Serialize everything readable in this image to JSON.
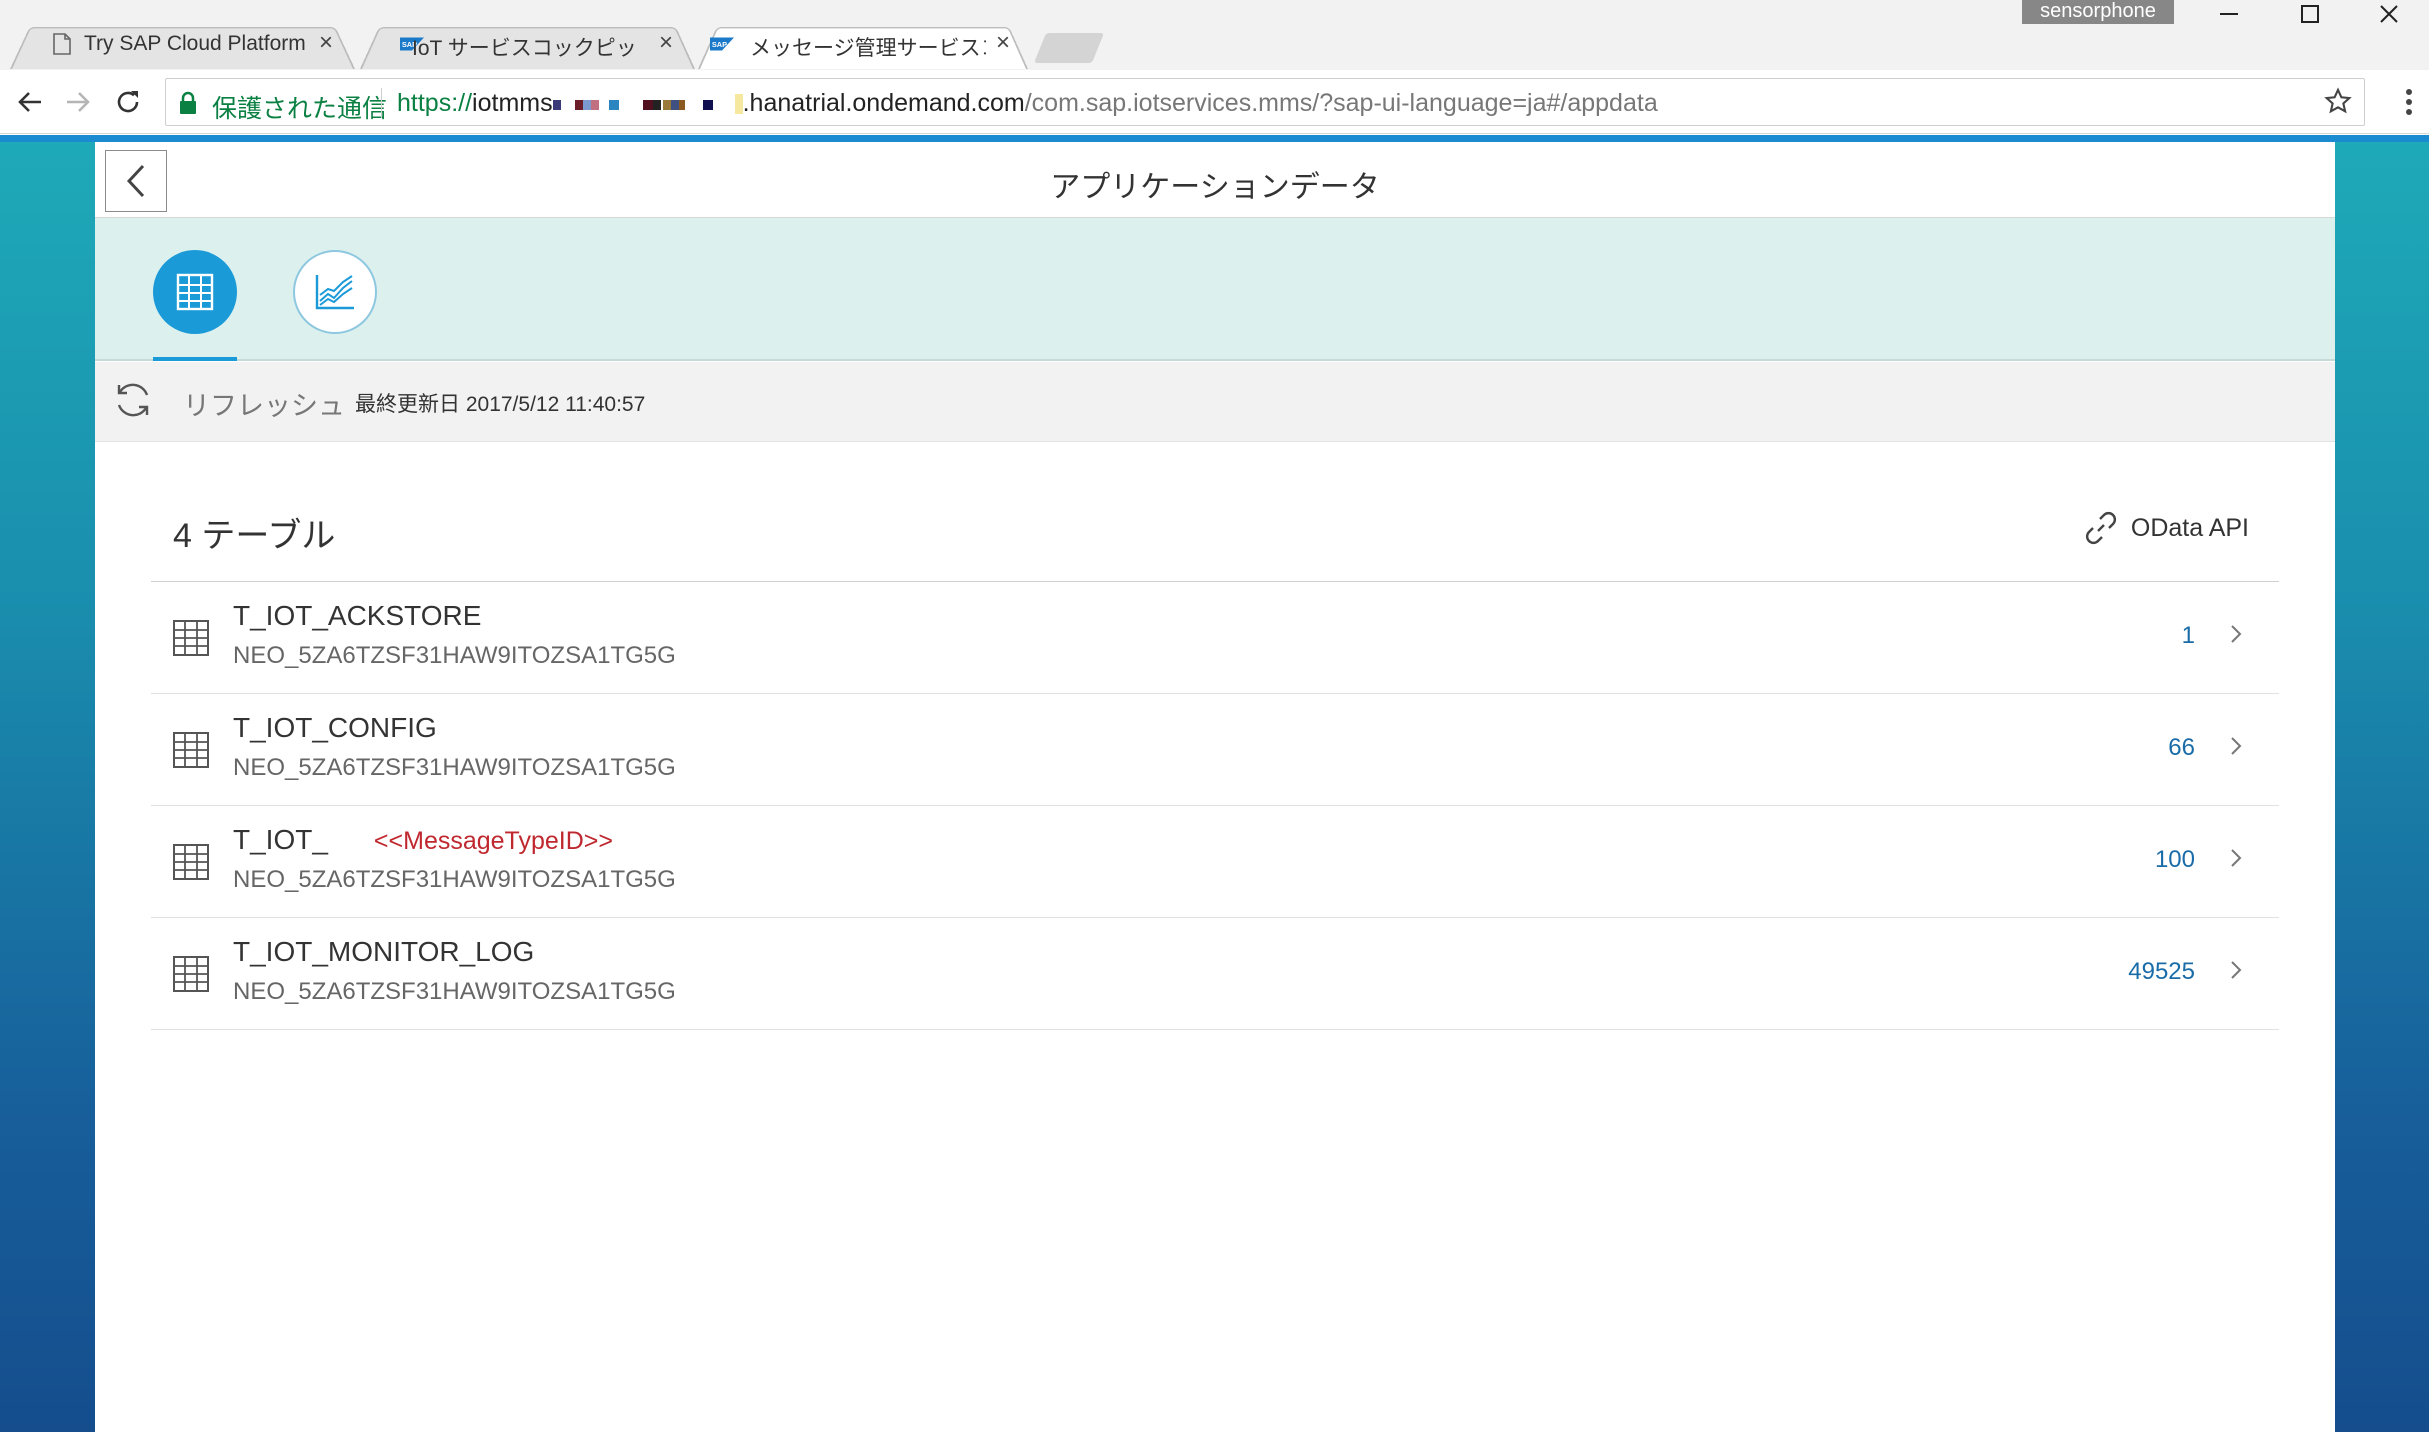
{
  "browser": {
    "tabs": [
      {
        "title": "Try SAP Cloud Platform",
        "icon": "page-icon",
        "active": false
      },
      {
        "title": "IoT サービスコックピット",
        "icon": "sap-logo-icon",
        "active": false
      },
      {
        "title": "メッセージ管理サービスコックピ",
        "icon": "sap-logo-icon",
        "active": true
      }
    ],
    "profile": "sensorphone",
    "security_label": "保護された通信",
    "url": {
      "scheme": "https://",
      "host_prefix": "iotmms",
      "host_suffix": ".hanatrial.ondemand.com",
      "path": "/com.sap.iotservices.mms/?sap-ui-language=ja#/appdata"
    }
  },
  "page": {
    "title": "アプリケーションデータ",
    "refresh_label": "リフレッシュ",
    "last_updated": "最終更新日 2017/5/12 11:40:57",
    "table_count_title": "4 テーブル",
    "odata_label": "OData API",
    "tables": [
      {
        "name": "T_IOT_ACKSTORE",
        "schema": "NEO_5ZA6TZSF31HAW9ITOZSA1TG5G",
        "count": "1"
      },
      {
        "name": "T_IOT_CONFIG",
        "schema": "NEO_5ZA6TZSF31HAW9ITOZSA1TG5G",
        "count": "66"
      },
      {
        "name": "T_IOT_",
        "annotation": "<<MessageTypeID>>",
        "schema": "NEO_5ZA6TZSF31HAW9ITOZSA1TG5G",
        "count": "100"
      },
      {
        "name": "T_IOT_MONITOR_LOG",
        "schema": "NEO_5ZA6TZSF31HAW9ITOZSA1TG5G",
        "count": "49525"
      }
    ]
  },
  "colors": {
    "accent": "#1b9ad8",
    "count_text": "#1a6ca8",
    "annotation": "#c0282f",
    "secure_green": "#0b8043"
  }
}
